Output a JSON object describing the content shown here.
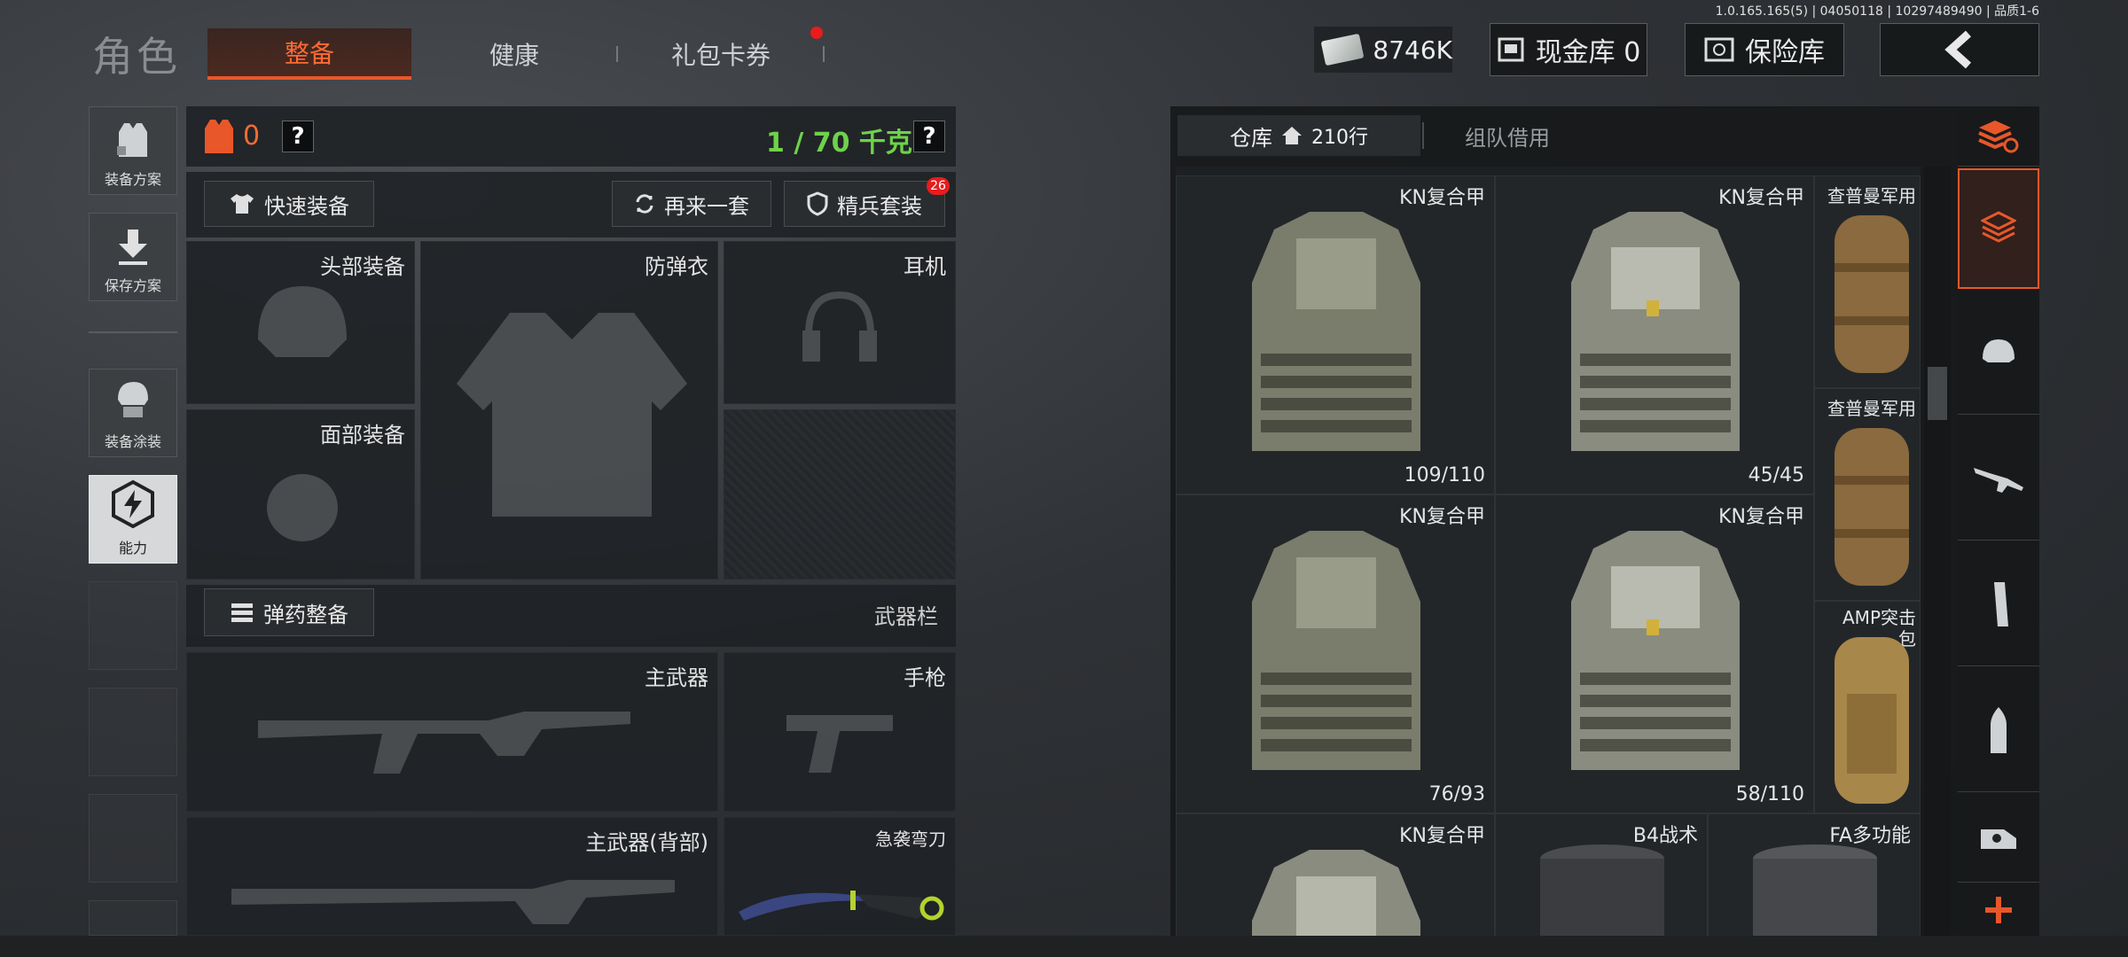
{
  "header": {
    "title": "角色",
    "tabs": [
      {
        "label": "整备",
        "active": true
      },
      {
        "label": "健康",
        "active": false
      },
      {
        "label": "礼包卡券",
        "active": false,
        "badge_dot": true
      }
    ],
    "version": "1.0.165.165(5) | 04050118 | 10297489490 | 品质1-6",
    "currency": {
      "icon": "cash-icon",
      "value": "8746K"
    },
    "cash_vault": {
      "label": "现金库 0",
      "icon": "cash-vault-icon"
    },
    "safe": {
      "label": "保险库",
      "icon": "safe-icon"
    },
    "back_icon": "chevron-left-icon"
  },
  "sidebar": {
    "items": [
      {
        "label": "装备方案",
        "icon": "vest-loadout-icon"
      },
      {
        "label": "保存方案",
        "icon": "download-save-icon"
      },
      {
        "label": "装备涂装",
        "icon": "helmet-paint-icon"
      },
      {
        "label": "能力",
        "icon": "lightning-hexagon-icon"
      }
    ]
  },
  "equipment": {
    "armor_count": "0",
    "help": "?",
    "weight": "1 / 70 千克",
    "quick_equip": "快速装备",
    "reroll": "再来一套",
    "elite_set": "精兵套装",
    "elite_badge": "26",
    "slots": {
      "head": "头部装备",
      "vest": "防弹衣",
      "ear": "耳机",
      "face": "面部装备"
    },
    "ammo": "弹药整备",
    "weapon_bar": "武器栏",
    "weapons": {
      "primary": "主武器",
      "pistol": "手枪",
      "primary_back": "主武器(背部)",
      "knife": "急袭弯刀"
    }
  },
  "warehouse": {
    "tab_warehouse": "仓库",
    "rows": "210行",
    "tab_team": "组队借用",
    "items": [
      {
        "name": "KN复合甲",
        "durability": "109/110"
      },
      {
        "name": "KN复合甲",
        "durability": "45/45"
      },
      {
        "name": "查普曼军用"
      },
      {
        "name": "查普曼军用"
      },
      {
        "name": "KN复合甲",
        "durability": "76/93"
      },
      {
        "name": "KN复合甲",
        "durability": "58/110"
      },
      {
        "name": "AMP突击包"
      },
      {
        "name": "KN复合甲"
      },
      {
        "name": "B4战术"
      },
      {
        "name": "FA多功能"
      }
    ],
    "amp_line1": "AMP突击",
    "amp_line2": "包"
  },
  "categories": [
    "stack-refresh-icon",
    "layers-icon",
    "helmet-icon",
    "rifle-icon",
    "magazine-icon",
    "bullet-icon",
    "scope-icon",
    "plus-icon"
  ],
  "colors": {
    "accent": "#e8572a",
    "weight_green": "#6ed24a",
    "badge_red": "#e81c1c"
  }
}
